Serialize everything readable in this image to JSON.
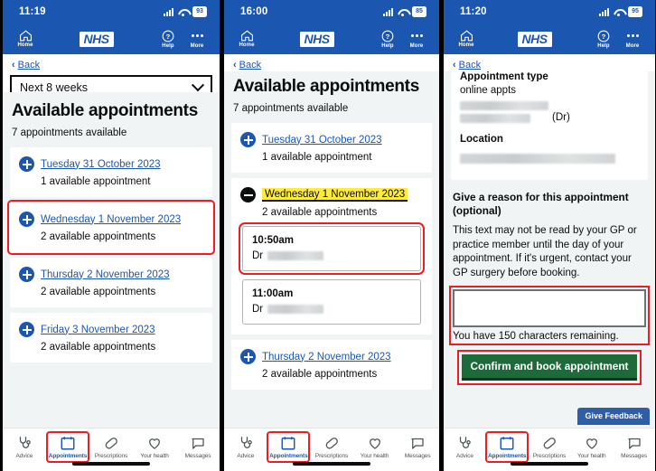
{
  "panels": [
    {
      "status": {
        "time": "11:19",
        "battery": "93",
        "signal_icon": "signal-bars-icon",
        "wifi_icon": "wifi-icon"
      },
      "header": {
        "home_label": "Home",
        "help_label": "Help",
        "more_label": "More",
        "logo_text": "NHS"
      },
      "back_label": "Back",
      "filter": {
        "value": "Next 8 weeks",
        "chevron_icon": "chevron-down-icon"
      },
      "title": "Available appointments",
      "subtitle": "7 appointments available",
      "days": [
        {
          "date": "Tuesday 31 October 2023",
          "count": "1 available appointment",
          "expanded": false,
          "highlighted": false
        },
        {
          "date": "Wednesday 1 November 2023",
          "count": "2 available appointments",
          "expanded": false,
          "highlighted": true
        },
        {
          "date": "Thursday 2 November 2023",
          "count": "2 available appointments",
          "expanded": false,
          "highlighted": false
        },
        {
          "date": "Friday 3 November 2023",
          "count": "2 available appointments",
          "expanded": false,
          "highlighted": false
        }
      ]
    },
    {
      "status": {
        "time": "16:00",
        "battery": "85"
      },
      "title": "Available appointments",
      "subtitle": "7 appointments available",
      "back_label": "Back",
      "days": [
        {
          "date": "Tuesday 31 October 2023",
          "count": "1 available appointment"
        },
        {
          "date": "Wednesday 1 November 2023",
          "count": "2 available appointments"
        },
        {
          "date": "Thursday 2 November 2023",
          "count": "2 available appointments"
        }
      ],
      "slots": [
        {
          "time": "10:50am",
          "doctor_prefix": "Dr",
          "doctor_name": "",
          "highlighted": true
        },
        {
          "time": "11:00am",
          "doctor_prefix": "Dr",
          "doctor_name": "",
          "highlighted": false
        }
      ]
    },
    {
      "status": {
        "time": "11:20",
        "battery": "95"
      },
      "back_label": "Back",
      "detail": {
        "type_label": "Appointment type",
        "type_value": "online appts",
        "doctor_suffix": "(Dr)",
        "location_label": "Location"
      },
      "reason": {
        "heading_line1": "Give a reason for this appointment",
        "heading_line2": "(optional)",
        "body": "This text may not be read by your GP or practice member until the day of your appointment. If it's urgent, contact your GP surgery before booking.",
        "input_value": "",
        "char_count": "You have 150 characters remaining."
      },
      "confirm_label": "Confirm and book appointment",
      "feedback_label": "Give Feedback"
    }
  ],
  "bottom_nav": [
    {
      "label": "Advice",
      "icon": "stethoscope-icon",
      "active": false
    },
    {
      "label": "Appointments",
      "icon": "calendar-icon",
      "active": true
    },
    {
      "label": "Prescriptions",
      "icon": "pill-icon",
      "active": false
    },
    {
      "label": "Your health",
      "icon": "heart-icon",
      "active": false
    },
    {
      "label": "Messages",
      "icon": "speech-bubble-icon",
      "active": false
    }
  ],
  "colors": {
    "nhs_blue": "#1b57b1",
    "highlight_red": "#ee1c25",
    "focus_yellow": "#ffeb3b",
    "confirm_green": "#1d6b3a",
    "page_grey": "#f0f4f5"
  }
}
